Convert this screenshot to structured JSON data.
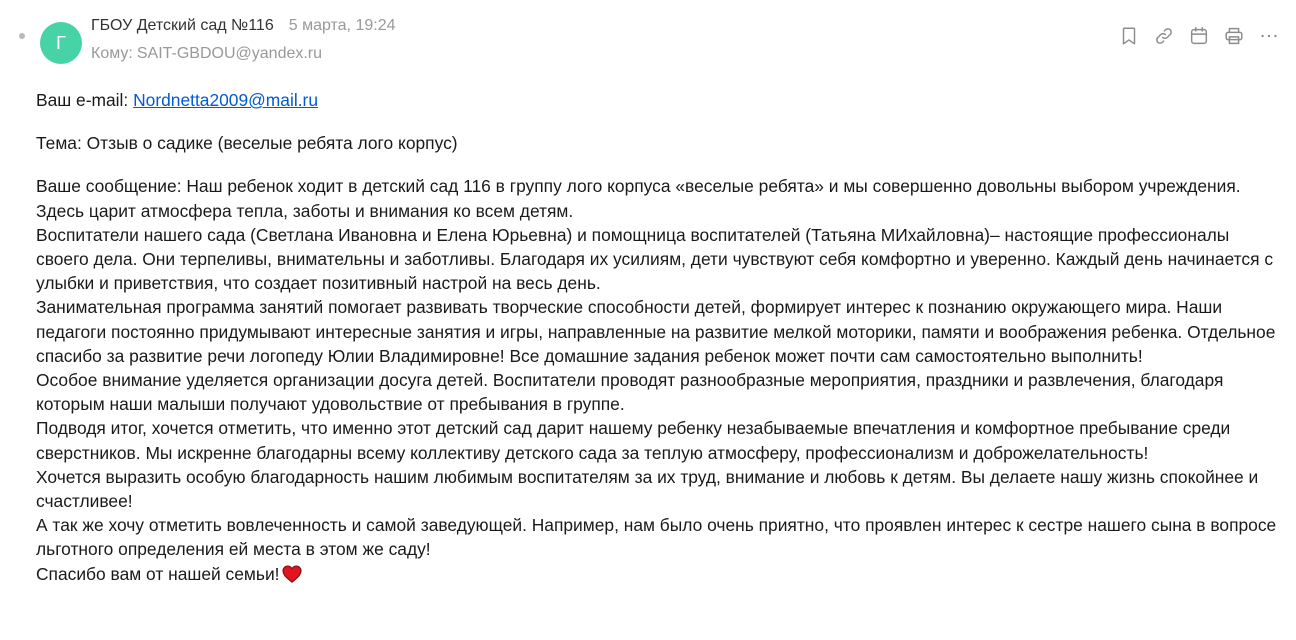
{
  "header": {
    "avatar_letter": "Г",
    "sender_name": "ГБОУ Детский сад №116",
    "date": "5 марта, 19:24",
    "to_label": "Кому:",
    "to_address": "SAIT-GBDOU@yandex.ru",
    "toolbar_icons": [
      "bookmark-icon",
      "link-icon",
      "calendar-icon",
      "print-icon",
      "more-icon"
    ]
  },
  "body": {
    "email_label": "Ваш e-mail:",
    "email_value": "Nordnetta2009@mail.ru",
    "subject_line": "Тема: Отзыв о садике (веселые ребята лого корпус)",
    "message_text": "Ваше сообщение: Наш ребенок ходит в детский сад 116 в группу лого корпуса «веселые ребята» и мы совершенно довольны выбором учреждения. Здесь царит атмосфера тепла, заботы и внимания ко всем детям.\nВоспитатели нашего сада (Светлана Ивановна и Елена Юрьевна) и помощница воспитателей (Татьяна МИхайловна)– настоящие профессионалы своего дела. Они терпеливы, внимательны и заботливы. Благодаря их усилиям, дети чувствуют себя комфортно и уверенно. Каждый день начинается с улыбки и приветствия, что создает позитивный настрой на весь день.\nЗанимательная программа занятий помогает развивать творческие способности детей, формирует интерес к познанию окружающего мира. Наши педагоги постоянно придумывают интересные занятия и игры, направленные на развитие мелкой моторики, памяти и воображения ребенка. Отдельное спасибо за развитие речи логопеду Юлии Владимировне! Все домашние задания ребенок может почти сам самостоятельно выполнить!\nОсобое внимание уделяется организации досуга детей. Воспитатели проводят разнообразные мероприятия, праздники и развлечения, благодаря которым наши малыши получают удовольствие от пребывания в группе.\nПодводя итог, хочется отметить, что именно этот детский сад дарит нашему ребенку незабываемые впечатления и комфортное пребывание среди сверстников. Мы искренне благодарны всему коллективу детского сада за теплую атмосферу, профессионализм и доброжелательность!\nХочется выразить особую благодарность нашим любимым воспитателям за их труд, внимание и любовь к детям. Вы делаете нашу жизнь спокойнее и счастливее!\nА так же хочу отметить вовлеченность и самой заведующей. Например, нам было очень приятно, что проявлен интерес к сестре нашего сына в вопросе льготного определения ей места в этом же саду!",
    "closing_text": "Спасибо вам от нашей семьи!",
    "closing_emoji": "heart-icon"
  },
  "colors": {
    "avatar": "#47d3a6",
    "link": "#005bd1",
    "muted": "#999999",
    "heart": "#e0151f"
  }
}
